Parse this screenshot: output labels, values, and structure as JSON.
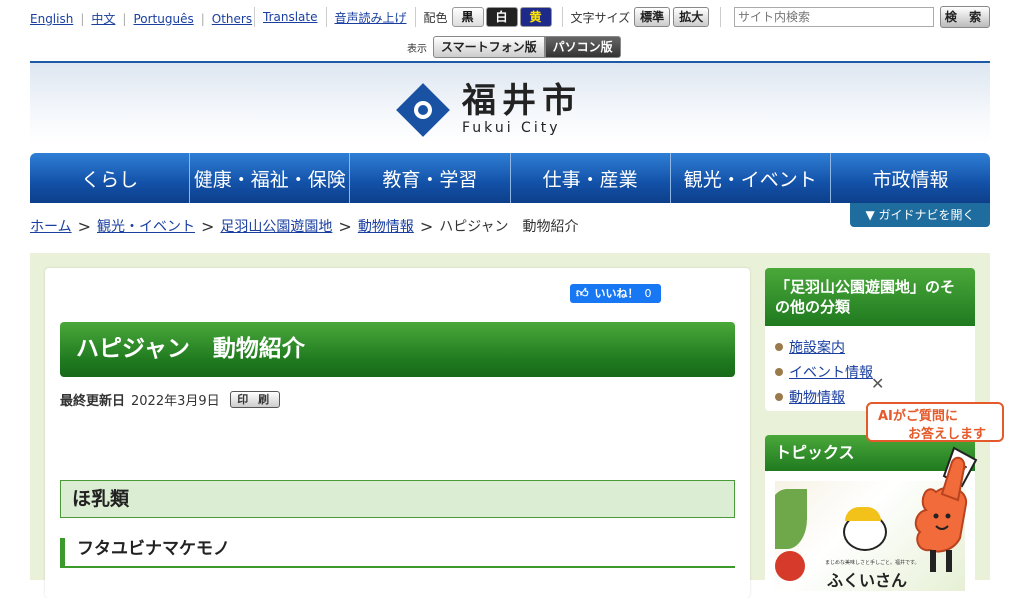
{
  "util": {
    "languages": [
      "English",
      "中文",
      "Português",
      "Others"
    ],
    "translate": "Translate",
    "read_aloud": "音声読み上げ",
    "color_label": "配色",
    "color_options": [
      "黒",
      "白",
      "黄"
    ],
    "text_size_label": "文字サイズ",
    "text_size_options": [
      "標準",
      "拡大"
    ],
    "search_placeholder": "サイト内検索",
    "search_button": "検 索",
    "display_label": "表示",
    "display_options": [
      "スマートフォン版",
      "パソコン版"
    ]
  },
  "header": {
    "logo_jp": "福井市",
    "logo_en": "Fukui City"
  },
  "nav": [
    "くらし",
    "健康・福祉・保険",
    "教育・学習",
    "仕事・産業",
    "観光・イベント",
    "市政情報"
  ],
  "breadcrumb": {
    "links": [
      "ホーム",
      "観光・イベント",
      "足羽山公園遊園地",
      "動物情報"
    ],
    "current": "ハピジャン　動物紹介",
    "separator": ">"
  },
  "guide_button": "ガイドナビを開く",
  "main": {
    "like_label": "いいね！",
    "like_count": "0",
    "title": "ハピジャン　動物紹介",
    "updated_label": "最終更新日",
    "updated_date": "2022年3月9日",
    "print_button": "印 刷",
    "h2": "ほ乳類",
    "h3": "フタユビナマケモノ"
  },
  "sidebar": {
    "box1_title": "「足羽山公園遊園地」のその他の分類",
    "box1_items": [
      "施設案内",
      "イベント情報",
      "動物情報"
    ],
    "box2_title": "トピックス",
    "topic_caption": "まじめな美味しさと手しごと。福井です。",
    "topic_big": "ふくいさん"
  },
  "ai_widget": {
    "line1": "AIがご質問に",
    "line2": "お答えします",
    "badge": "福",
    "close": "✕"
  },
  "colors": {
    "nav_blue": "#1351a8",
    "green": "#1f7a1f",
    "accent_orange": "#e55a2a"
  }
}
